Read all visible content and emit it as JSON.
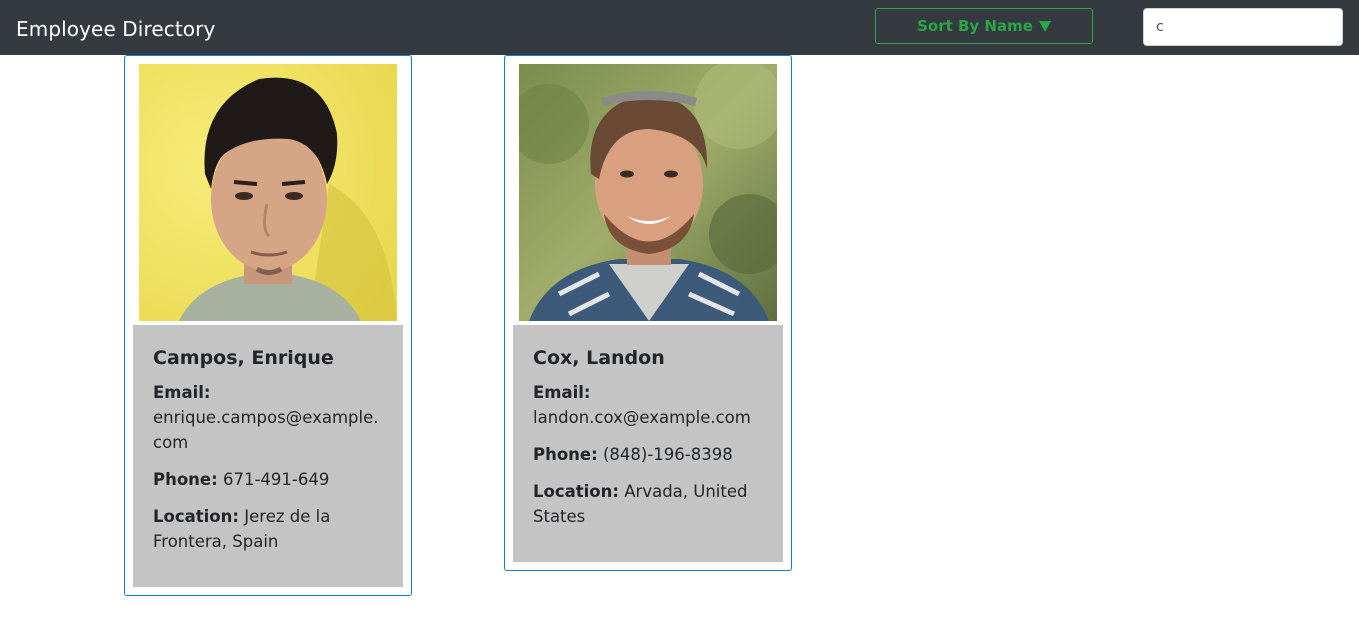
{
  "navbar": {
    "brand": "Employee Directory",
    "sort_label": "Sort By Name",
    "search_value": "c",
    "accent": "#28a745",
    "background": "#343a40"
  },
  "employees": [
    {
      "name": "Campos, Enrique",
      "email_label": "Email:",
      "email": "enrique.campos@example.com",
      "phone_label": "Phone:",
      "phone": "671-491-649",
      "location_label": "Location:",
      "location": "Jerez de la Frontera, Spain",
      "photo": "portrait-yellow-background"
    },
    {
      "name": "Cox, Landon",
      "email_label": "Email:",
      "email": "landon.cox@example.com",
      "phone_label": "Phone:",
      "phone": "(848)-196-8398",
      "location_label": "Location:",
      "location": "Arvada, United States",
      "photo": "portrait-green-background"
    }
  ]
}
